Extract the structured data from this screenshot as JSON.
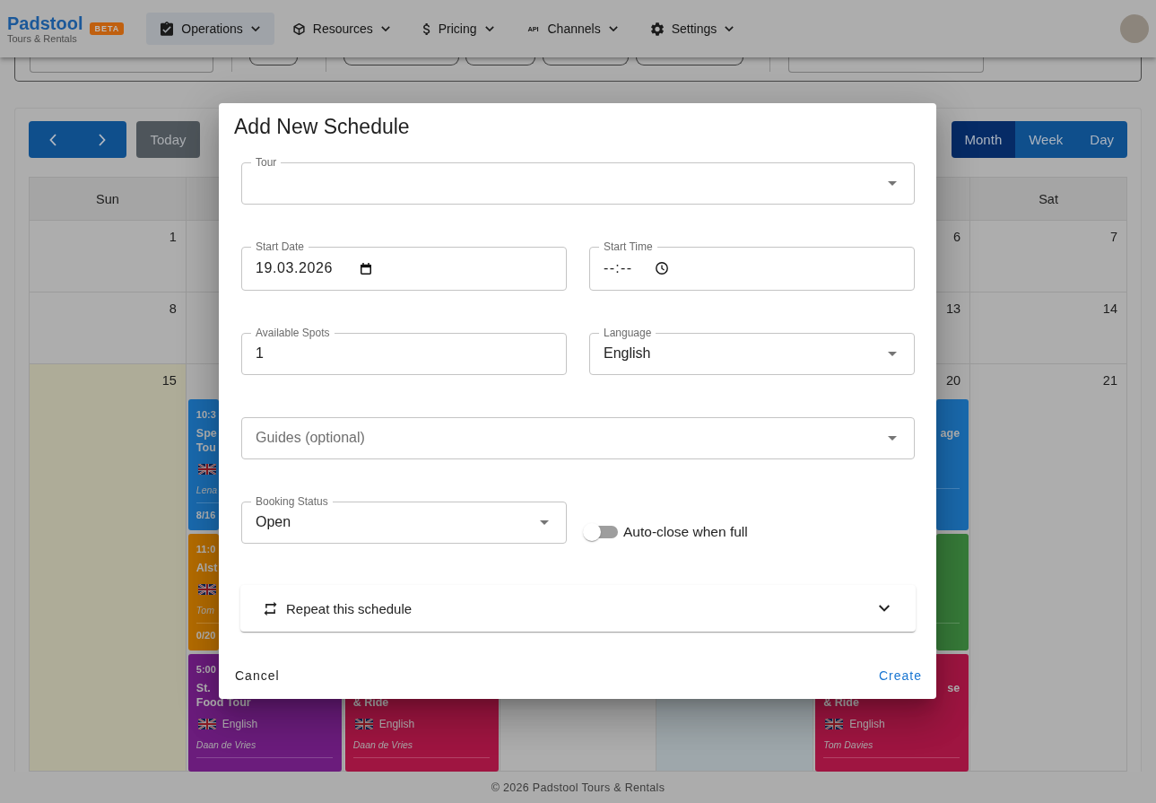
{
  "navbar": {
    "logo": {
      "name": "Padstool",
      "tagline": "Tours & Rentals",
      "badge": "BETA"
    },
    "menu": [
      {
        "label": "Operations",
        "selected": true
      },
      {
        "label": "Resources",
        "selected": false
      },
      {
        "label": "Pricing",
        "selected": false
      },
      {
        "label": "Channels",
        "icon_text": "API",
        "selected": false
      },
      {
        "label": "Settings",
        "selected": false
      }
    ]
  },
  "calendar": {
    "today_button": "Today",
    "views": [
      {
        "label": "Month",
        "selected": true
      },
      {
        "label": "Week",
        "selected": false
      },
      {
        "label": "Day",
        "selected": false
      }
    ],
    "weekdays": {
      "sun": "Sun",
      "sat": "Sat"
    },
    "weeks": [
      {
        "days": {
          "sun": {
            "day": "1",
            "today": false,
            "selected": false
          },
          "mon": {
            "today": false,
            "selected": false
          },
          "fri": {
            "day": "6",
            "today": false,
            "selected": false
          },
          "sat": {
            "day": "7",
            "today": false,
            "selected": false
          }
        }
      },
      {
        "days": {
          "sun": {
            "day": "8",
            "today": false,
            "selected": false
          },
          "mon": {
            "today": false,
            "selected": false
          },
          "fri": {
            "day": "13",
            "today": false,
            "selected": false
          },
          "sat": {
            "day": "14",
            "today": false,
            "selected": false
          }
        }
      },
      {
        "days": {
          "sun": {
            "day": "15",
            "today": true,
            "selected": false
          },
          "mon": {
            "today": false,
            "selected": false
          },
          "tue": {
            "today": false,
            "selected": false
          },
          "wed": {
            "today": false,
            "selected": false
          },
          "thu": {
            "today": false,
            "selected": true
          },
          "fri": {
            "day": "20",
            "today": false,
            "selected": false
          },
          "sat": {
            "day": "21",
            "today": false,
            "selected": false
          }
        },
        "event_rows": [
          {
            "mon": {
              "color": "#1a6aae",
              "time": "10:3",
              "title_line_1": {
                "text": "Spe"
              },
              "title_line_2": {
                "text": "Tou"
              },
              "flag": true,
              "guide": "Lena",
              "booked": "8/16"
            },
            "fri": {
              "color": "#1a6aae",
              "title_line_1": {
                "text": "age",
                "clipped_left": true
              }
            }
          },
          {
            "mon": {
              "color": "#b46c02",
              "time": "11:0",
              "title_line_1": {
                "text": "Alst"
              },
              "flag": true,
              "guide": "Tom",
              "booked": "0/20"
            },
            "fri": {
              "color": "#377b39"
            }
          },
          {
            "mon": {
              "color": "#6b1c7c",
              "time": "5:00",
              "title_line_1": {
                "text": "St."
              },
              "title_line_2": {
                "text": "Food Tour"
              },
              "flag": true,
              "language": "English",
              "guide": "Daan de Vries"
            },
            "tue": {
              "color": "#9f1541",
              "title_line_2": {
                "text": "& Ride"
              },
              "flag": true,
              "language": "English",
              "guide": "Daan de Vries"
            },
            "fri": {
              "color": "#9f1541",
              "title_line_1": {
                "text": "se",
                "clipped_left": true
              },
              "title_line_2": {
                "text": "& Ride"
              },
              "flag": true,
              "language": "English",
              "guide": "Tom Davies"
            }
          }
        ]
      }
    ]
  },
  "dialog": {
    "title": "Add New Schedule",
    "rows": [
      [
        {
          "kind": "select",
          "label": "Tour"
        }
      ],
      [
        {
          "kind": "date",
          "label": "Start Date",
          "value": "19.03.2026"
        },
        {
          "kind": "time",
          "label": "Start Time",
          "placeholder": "--:--"
        }
      ],
      [
        {
          "kind": "number",
          "label": "Available Spots",
          "value": "1"
        },
        {
          "kind": "select",
          "label": "Language",
          "value": "English"
        }
      ],
      [
        {
          "kind": "select",
          "placeholder": "Guides (optional)"
        }
      ],
      [
        {
          "kind": "select",
          "label": "Booking Status",
          "value": "Open"
        },
        {
          "kind": "switch",
          "label": "Auto-close when full",
          "on": false
        }
      ]
    ],
    "accordion": {
      "label": "Repeat this schedule",
      "expanded": false
    },
    "actions": [
      {
        "label": "Cancel",
        "kind": "dismiss"
      },
      {
        "label": "Create",
        "kind": "confirm"
      }
    ]
  },
  "footer": "© 2026 Padstool Tours & Rentals"
}
